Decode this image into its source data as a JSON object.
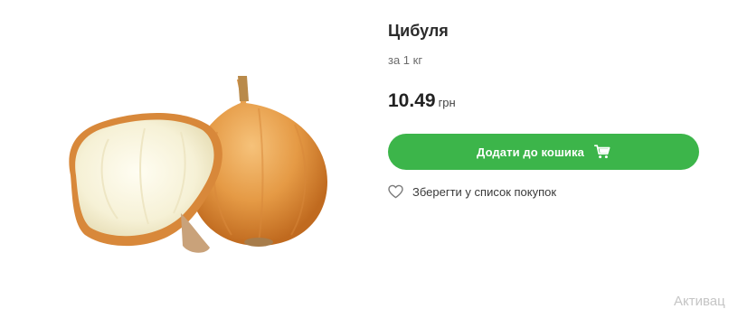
{
  "product": {
    "title": "Цибуля",
    "unit": "за 1 кг",
    "price": "10.49",
    "currency": "грн",
    "add_to_cart_label": "Додати до кошика",
    "save_to_list_label": "Зберегти у список покупок",
    "image_subject": "onion"
  },
  "overlay": {
    "activate_text": "Активац"
  },
  "colors": {
    "accent": "#3cb54a",
    "title": "#2b2b2b",
    "muted": "#6b6b6b"
  },
  "icons": {
    "cart": "cart-icon",
    "heart": "heart-icon"
  }
}
